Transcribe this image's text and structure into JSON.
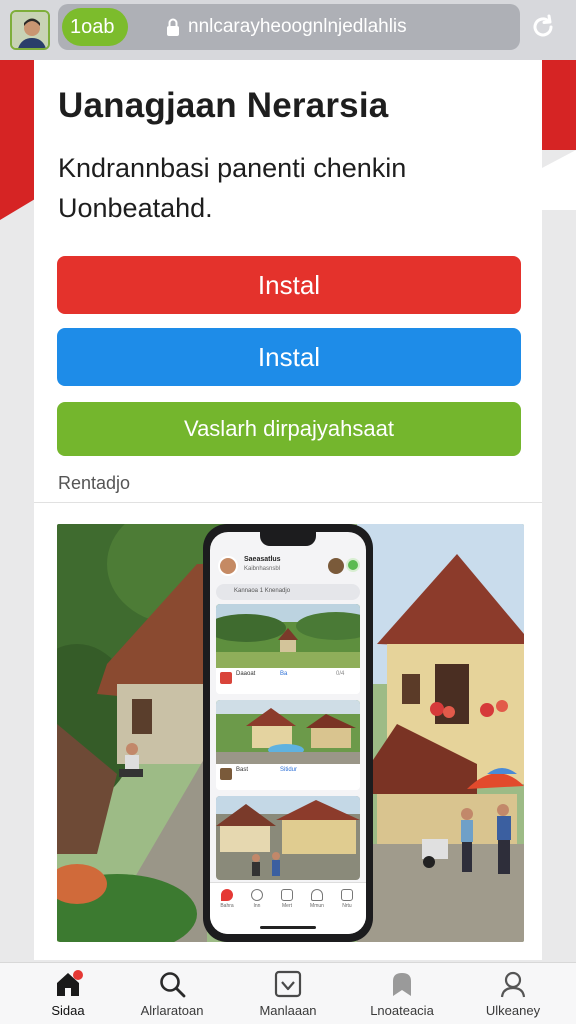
{
  "browser": {
    "tab_label": "1oab",
    "url": "nnlcarayheoognlnjedlahlis"
  },
  "page": {
    "title": "Uanagjaan Nerarsia",
    "subtitle": "Kndrannbasi panenti chenkin Uonbeatahd.",
    "buttons": [
      {
        "label": "Instal",
        "color": "#e4322c"
      },
      {
        "label": "Instal",
        "color": "#1e8ce8"
      },
      {
        "label": "Vaslarh dirpajyahsaat",
        "color": "#74b62d"
      }
    ],
    "section_label": "Rentadjo"
  },
  "phone": {
    "header_name": "Saeasatlus",
    "header_sub": "Kaibnhasnsbl",
    "search_text": "Kannaoa 1 Knenadjo",
    "rows": [
      {
        "label": "Daaoat",
        "tag": "Ba",
        "num": "0/4"
      },
      {
        "label": "Bast",
        "tag": "Sitidur",
        "num": ""
      }
    ],
    "tabs": [
      "Bahra",
      "Inn",
      "Mert",
      "Mmun",
      "Nrtu"
    ]
  },
  "bottom_nav": {
    "items": [
      {
        "label": "Sidaa",
        "icon": "home-icon"
      },
      {
        "label": "Alrlaratoan",
        "icon": "search-icon"
      },
      {
        "label": "Manlaaan",
        "icon": "check-box-icon"
      },
      {
        "label": "Lnoateacia",
        "icon": "bookmark-icon"
      },
      {
        "label": "Ulkeaney",
        "icon": "user-icon"
      }
    ]
  },
  "colors": {
    "accent_red": "#e4322c",
    "accent_blue": "#1e8ce8",
    "accent_green": "#74b62d",
    "notification_dot": "#e53935"
  }
}
